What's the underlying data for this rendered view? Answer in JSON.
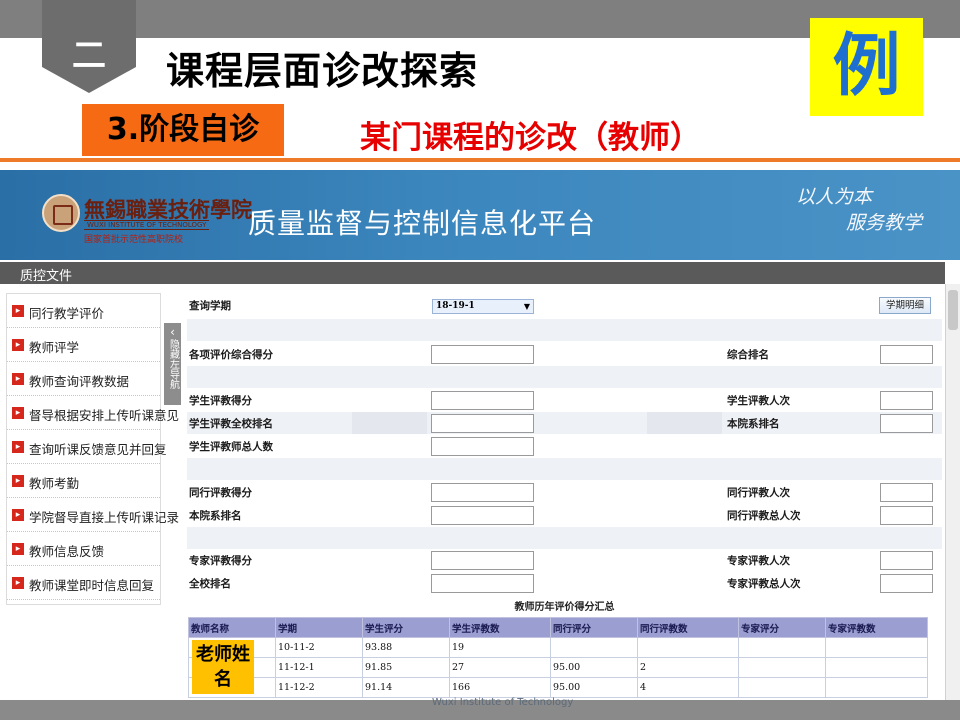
{
  "slide": {
    "section_number": "二",
    "title": "课程层面诊改探索",
    "example_label": "例",
    "stage_label": "3.阶段自诊",
    "subtitle": "某门课程的诊改（教师）",
    "watermark": "Wuxi Institute of Technology"
  },
  "banner": {
    "school_name_cn": "無錫職業技術學院",
    "school_name_en": "WUXI INSTITUTE OF TECHNOLOGY",
    "school_tag": "国家首批示范性高职院校",
    "platform_title": "质量监督与控制信息化平台",
    "motto_line1": "以人为本",
    "motto_line2": "服务教学"
  },
  "nav": {
    "section": "质控文件"
  },
  "sidebar": {
    "items": [
      "同行教学评价",
      "教师评学",
      "教师查询评教数据",
      "督导根据安排上传听课意见",
      "查询听课反馈意见并回复",
      "教师考勤",
      "学院督导直接上传听课记录",
      "教师信息反馈",
      "教师课堂即时信息回复"
    ],
    "collapse_label": "隐藏左导航"
  },
  "form": {
    "semester_label": "查询学期",
    "semester_value": "18-19-1",
    "detail_button": "学期明细",
    "overall_score": "各项评价综合得分",
    "overall_rank": "综合排名",
    "student_score": "学生评教得分",
    "student_count": "学生评教人次",
    "student_school_rank": "学生评教全校排名",
    "dept_rank": "本院系排名",
    "student_total": "学生评教师总人数",
    "peer_score": "同行评教得分",
    "peer_count": "同行评教人次",
    "peer_dept_rank": "本院系排名",
    "peer_total": "同行评教总人次",
    "expert_score": "专家评教得分",
    "expert_count": "专家评教人次",
    "expert_school_rank": "全校排名",
    "expert_total": "专家评教总人次"
  },
  "history": {
    "title": "教师历年评价得分汇总",
    "columns": [
      "教师名称",
      "学期",
      "学生评分",
      "学生评教数",
      "同行评分",
      "同行评教数",
      "专家评分",
      "专家评教数"
    ],
    "rows": [
      [
        "",
        "10-11-2",
        "93.88",
        "19",
        "",
        "",
        "",
        ""
      ],
      [
        "",
        "11-12-1",
        "91.85",
        "27",
        "95.00",
        "2",
        "",
        ""
      ],
      [
        "",
        "11-12-2",
        "91.14",
        "166",
        "95.00",
        "4",
        "",
        ""
      ]
    ],
    "name_note": "老师姓名"
  }
}
